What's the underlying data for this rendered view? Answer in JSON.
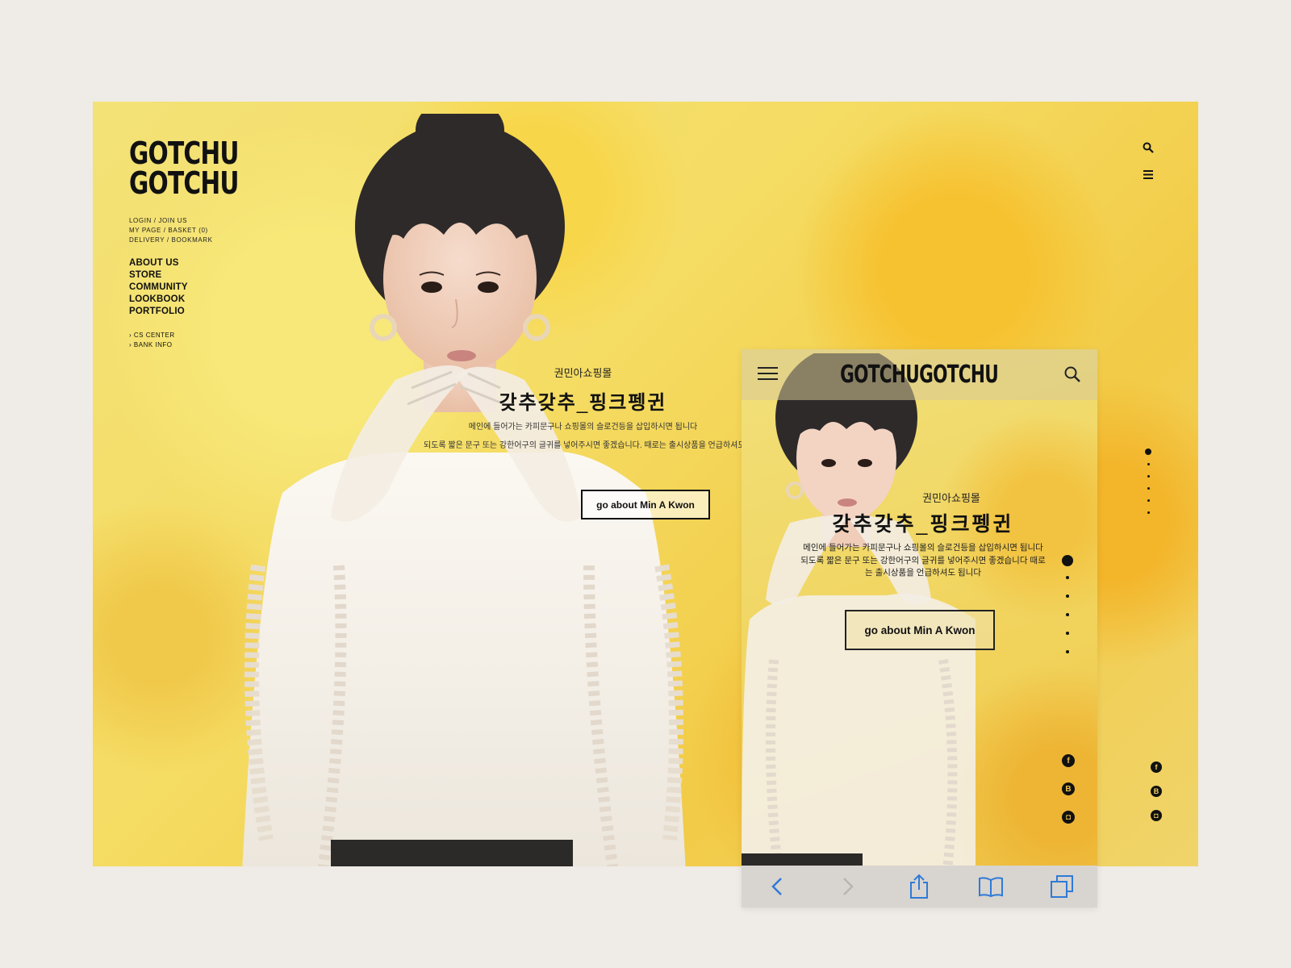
{
  "brand": {
    "logo_line1": "GOTCHU",
    "logo_line2": "GOTCHU",
    "mobile_logo": "GOTCHUGOTCHU"
  },
  "account_links": [
    "LOGIN / JOIN US",
    "MY PAGE / BASKET (0)",
    "DELIVERY / BOOKMARK"
  ],
  "main_nav": [
    "ABOUT US",
    "STORE",
    "COMMUNITY",
    "LOOKBOOK",
    "PORTFOLIO"
  ],
  "sub_nav": [
    "CS CENTER",
    "BANK INFO"
  ],
  "hero": {
    "subtitle": "권민아쇼핑몰",
    "title_left": "갖추갖추",
    "title_sep": "_",
    "title_right": "핑크펭귄",
    "desc_line1": "메인에 들어가는 카피문구나 쇼핑몰의 슬로건등을 삽입하시면 됩니다",
    "desc_line2": "되도록 짧은 문구 또는 강한어구의 글귀를 넣어주시면 좋겠습니다. 때로는 출시상품을 언급하셔도 됩니다",
    "button_label": "go about Min A Kwon"
  },
  "mobile_hero": {
    "subtitle": "권민아쇼핑몰",
    "title_left": "갖추갖추",
    "title_sep": "_",
    "title_right": "핑크펭귄",
    "desc_line1": "메인에 들어가는 카피문구나 쇼핑몰의 슬로건등을 삽입하시면 됩니다",
    "desc_line2": "되도록 짧은 문구 또는 강한어구의 글귀를 넣어주시면 좋겠습니다  때로",
    "desc_line3": "는 출시상품을 언급하셔도 됩니다",
    "button_label": "go about Min A Kwon"
  },
  "icons": [
    "search-icon",
    "menu-icon",
    "facebook-icon",
    "blogger-icon",
    "instagram-icon",
    "back-icon",
    "forward-icon",
    "share-icon",
    "bookmarks-icon",
    "tabs-icon"
  ],
  "social_glyphs": {
    "facebook": "f",
    "blogger": "B",
    "instagram": "◘"
  },
  "colors": {
    "background": "#efebe6",
    "yellow": "#f3dc63",
    "ink": "#111111",
    "safari_blue": "#2f7ad8"
  }
}
